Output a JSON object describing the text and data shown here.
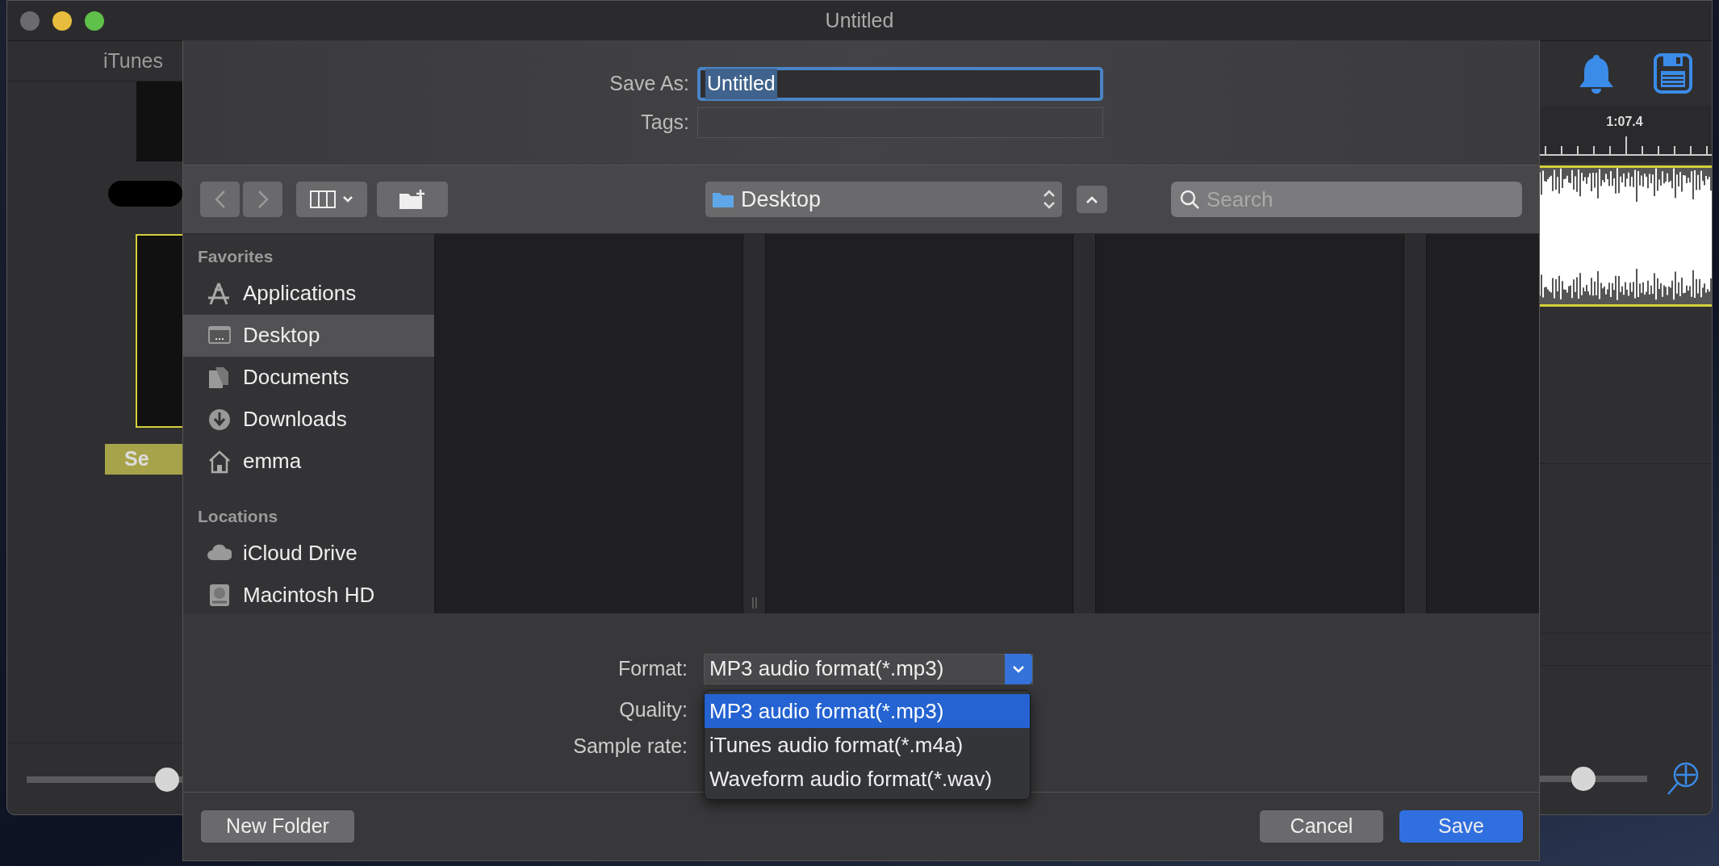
{
  "window": {
    "title": "Untitled"
  },
  "app": {
    "left_panel": {
      "header": "iTunes",
      "button_label": "Se",
      "slider": {
        "level": 0.9
      }
    },
    "right_panel": {
      "time": "1:07.4",
      "slider": {
        "level": 0.42
      }
    }
  },
  "dialog": {
    "save_as": {
      "label": "Save As:",
      "value": "Untitled"
    },
    "tags": {
      "label": "Tags:"
    },
    "location": "Desktop",
    "search": {
      "placeholder": "Search"
    },
    "sidebar": [
      {
        "heading": "Favorites",
        "items": [
          {
            "label": "Applications",
            "kind": "applications",
            "selected": false
          },
          {
            "label": "Desktop",
            "kind": "desktop",
            "selected": true
          },
          {
            "label": "Documents",
            "kind": "documents",
            "selected": false
          },
          {
            "label": "Downloads",
            "kind": "downloads",
            "selected": false
          },
          {
            "label": "emma",
            "kind": "home",
            "selected": false
          }
        ]
      },
      {
        "heading": "Locations",
        "items": [
          {
            "label": "iCloud Drive",
            "kind": "cloud",
            "selected": false
          },
          {
            "label": "Macintosh HD",
            "kind": "disk",
            "selected": false
          }
        ]
      }
    ],
    "options": [
      {
        "label": "Format:",
        "value": "MP3 audio format(*.mp3)"
      },
      {
        "label": "Quality:"
      },
      {
        "label": "Sample rate:"
      }
    ],
    "format_menu": [
      {
        "label": "MP3 audio format(*.mp3)",
        "selected": true
      },
      {
        "label": "iTunes audio format(*.m4a)",
        "selected": false
      },
      {
        "label": "Waveform audio format(*.wav)",
        "selected": false
      }
    ],
    "buttons": {
      "new_folder": "New Folder",
      "cancel": "Cancel",
      "save": "Save"
    }
  }
}
